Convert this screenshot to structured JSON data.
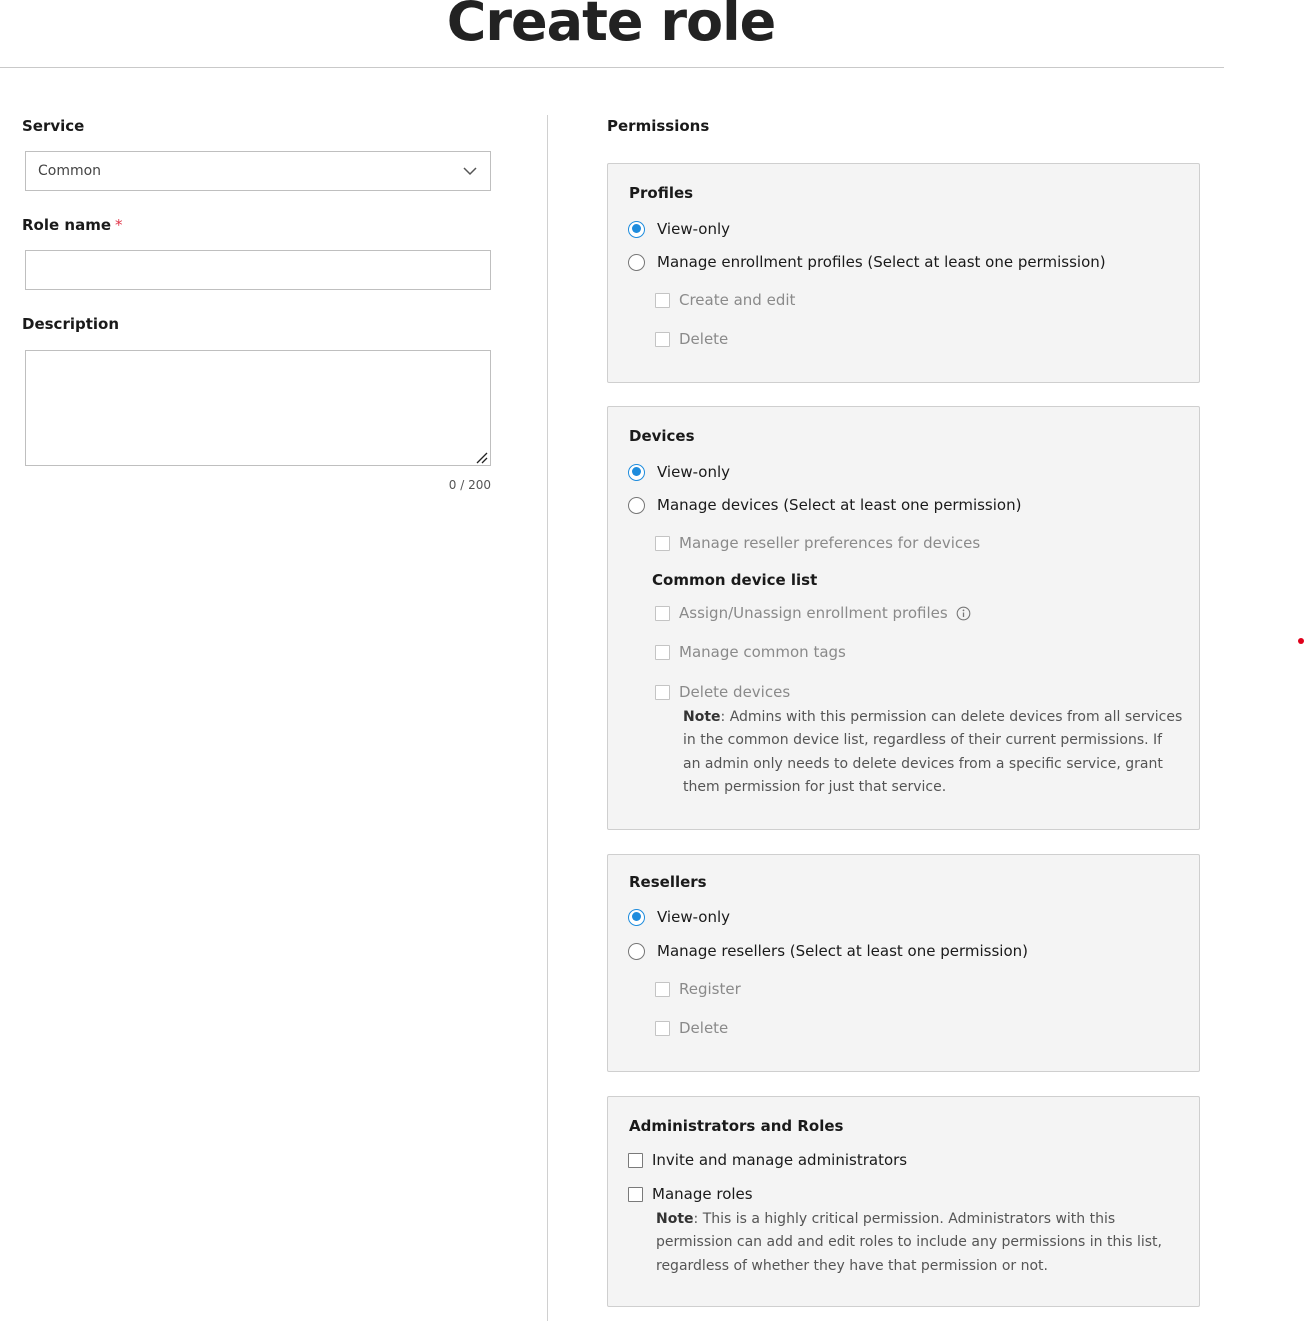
{
  "header": {
    "title": "Create role"
  },
  "form": {
    "service_label": "Service",
    "service_value": "Common",
    "role_name_label": "Role name",
    "required_marker": "*",
    "role_name_value": "",
    "description_label": "Description",
    "description_value": "",
    "char_count": "0 / 200"
  },
  "permissions": {
    "heading": "Permissions",
    "profiles": {
      "title": "Profiles",
      "view_only": "View-only",
      "manage": "Manage enrollment profiles (Select at least one permission)",
      "create_edit": "Create and edit",
      "delete": "Delete"
    },
    "devices": {
      "title": "Devices",
      "view_only": "View-only",
      "manage": "Manage devices (Select at least one permission)",
      "reseller_prefs": "Manage reseller preferences for devices",
      "common_list_title": "Common device list",
      "assign_profiles": "Assign/Unassign enrollment profiles",
      "manage_tags": "Manage common tags",
      "delete_devices": "Delete devices",
      "note_label": "Note",
      "note_text": ": Admins with this permission can delete devices from all services in the common device list, regardless of their current permissions. If an admin only needs to delete devices from a specific service, grant them permission for just that service."
    },
    "resellers": {
      "title": "Resellers",
      "view_only": "View-only",
      "manage": "Manage resellers (Select at least one permission)",
      "register": "Register",
      "delete": "Delete"
    },
    "admins": {
      "title": "Administrators and Roles",
      "invite": "Invite and manage administrators",
      "manage_roles": "Manage roles",
      "note_label": "Note",
      "note_text": ": This is a highly critical permission. Administrators with this permission can add and edit roles to include any permissions in this list, regardless of whether they have that permission or not."
    }
  },
  "icons": {
    "dropdown": "chevron-down-icon",
    "info": "info-icon",
    "resize": "resize-grip-icon"
  },
  "colors": {
    "accent": "#1e8cdd",
    "required": "#e0364a",
    "panel_bg": "#f4f4f4"
  }
}
